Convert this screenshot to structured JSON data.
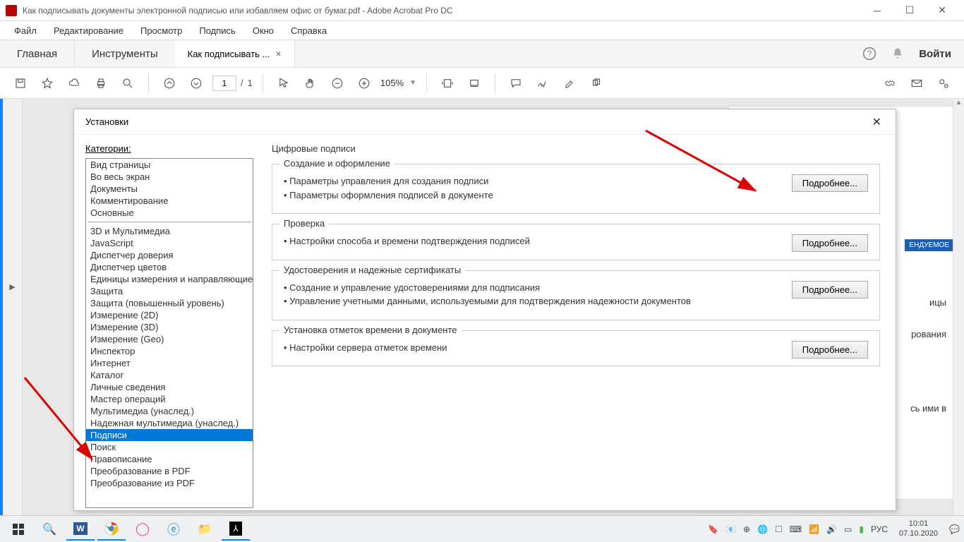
{
  "window": {
    "title": "Как подписывать документы электронной подписью или избавляем офис от бумаг.pdf - Adobe Acrobat Pro DC"
  },
  "menubar": [
    "Файл",
    "Редактирование",
    "Просмотр",
    "Подпись",
    "Окно",
    "Справка"
  ],
  "tabs": {
    "home": "Главная",
    "tools": "Инструменты",
    "doc": "Как подписывать ...",
    "login": "Войти"
  },
  "toolbar": {
    "page_current": "1",
    "page_total": "1",
    "zoom": "105%"
  },
  "dialog": {
    "title": "Установки",
    "categories_label": "Категории:",
    "group1": [
      "Вид страницы",
      "Во весь экран",
      "Документы",
      "Комментирование",
      "Основные"
    ],
    "group2": [
      "3D и Мультимедиа",
      "JavaScript",
      "Диспетчер доверия",
      "Диспетчер цветов",
      "Единицы измерения и направляющие",
      "Защита",
      "Защита (повышенный уровень)",
      "Измерение (2D)",
      "Измерение (3D)",
      "Измерение (Geo)",
      "Инспектор",
      "Интернет",
      "Каталог",
      "Личные сведения",
      "Мастер операций",
      "Мультимедиа (унаслед.)",
      "Надежная мультимедиа (унаслед.)",
      "Подписи",
      "Поиск",
      "Правописание",
      "Преобразование в PDF",
      "Преобразование из PDF"
    ],
    "selected": "Подписи",
    "panel_title": "Цифровые подписи",
    "sections": [
      {
        "legend": "Создание и оформление",
        "bullets": [
          "Параметры управления для создания подписи",
          "Параметры оформления подписей в документе"
        ],
        "button": "Подробнее..."
      },
      {
        "legend": "Проверка",
        "bullets": [
          "Настройки способа и времени подтверждения подписей"
        ],
        "button": "Подробнее..."
      },
      {
        "legend": "Удостоверения и надежные сертификаты",
        "bullets": [
          "Создание и управление удостоверениями для подписания",
          "Управление учетными данными, используемыми для подтверждения надежности документов"
        ],
        "button": "Подробнее..."
      },
      {
        "legend": "Установка отметок времени в документе",
        "bullets": [
          "Настройки сервера отметок времени"
        ],
        "button": "Подробнее..."
      }
    ]
  },
  "right_peek": {
    "badge": "ЕНДУЕМОЕ",
    "hint1": "ицы",
    "hint2": "рования",
    "hint3": "сь ими в"
  },
  "taskbar": {
    "lang": "РУС",
    "time": "10:01",
    "date": "07.10.2020"
  }
}
